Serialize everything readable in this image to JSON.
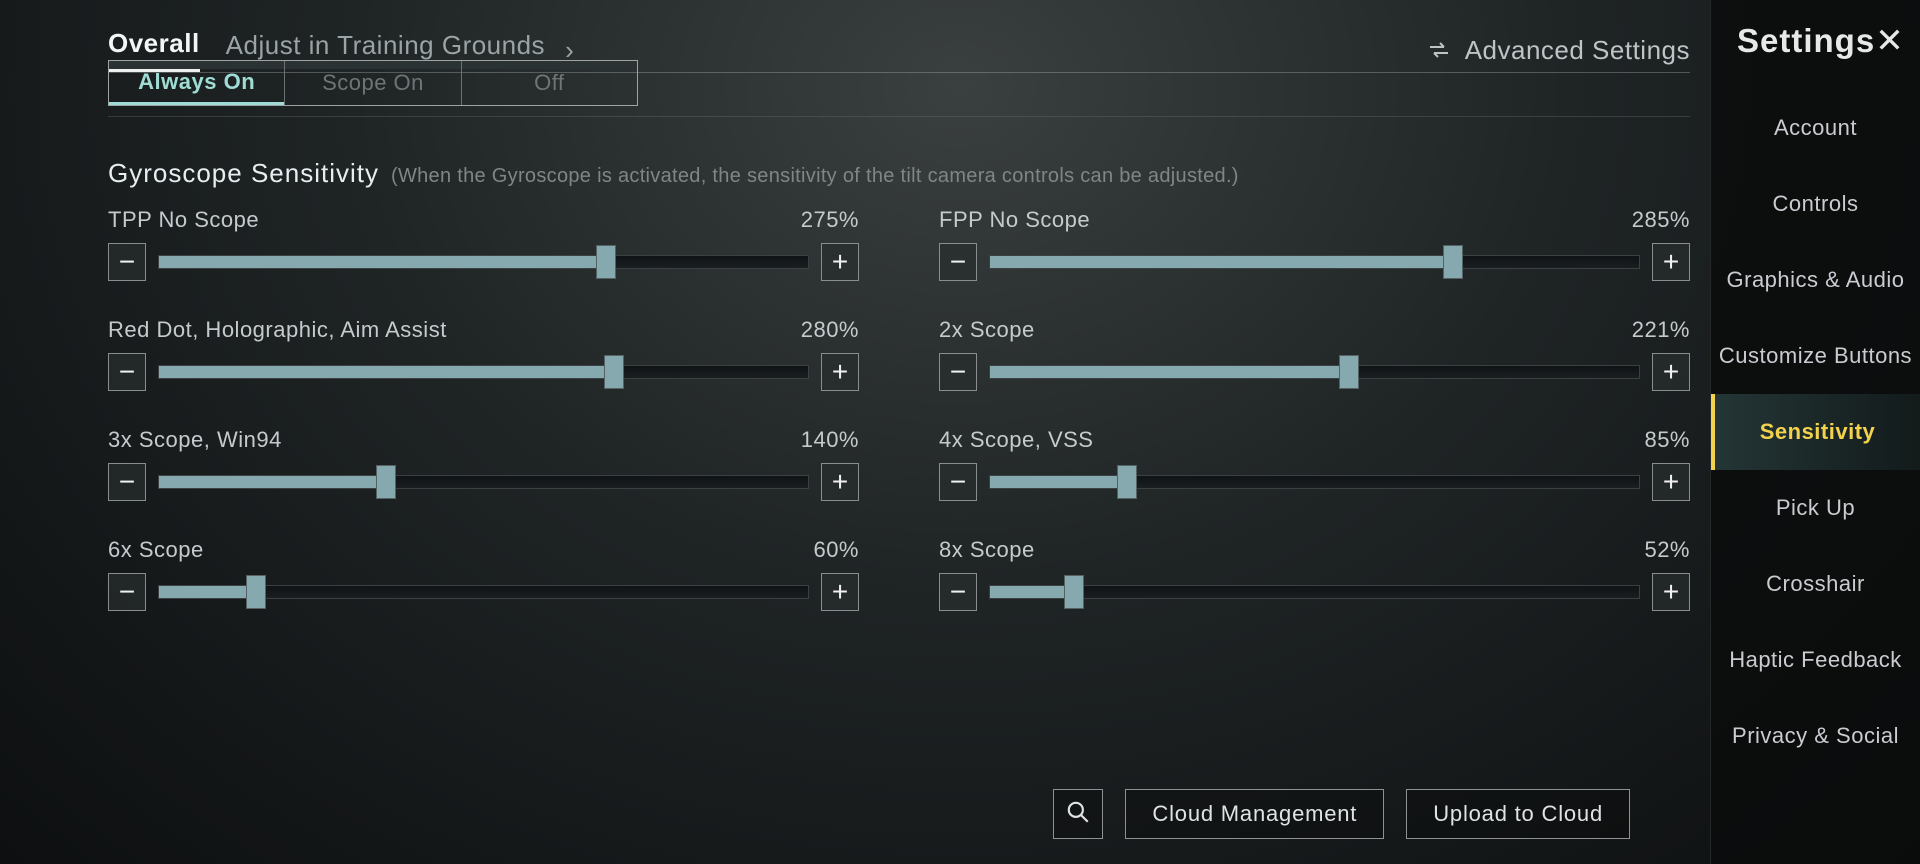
{
  "header": {
    "settings_label": "Settings",
    "advanced_label": "Advanced Settings",
    "tabs": [
      "Overall",
      "Adjust in Training Grounds"
    ],
    "active_tab_index": 0
  },
  "seg": {
    "options": [
      "Always On",
      "Scope On",
      "Off"
    ],
    "active_index": 0
  },
  "sidebar": {
    "items": [
      "Account",
      "Controls",
      "Graphics & Audio",
      "Customize Buttons",
      "Sensitivity",
      "Pick Up",
      "Crosshair",
      "Haptic Feedback",
      "Privacy & Social"
    ],
    "active_index": 4
  },
  "section": {
    "title": "Gyroscope Sensitivity",
    "hint": "(When the Gyroscope is activated, the sensitivity of the tilt camera controls can be adjusted.)"
  },
  "sliders": [
    {
      "label": "TPP No Scope",
      "value": 275,
      "display_max": 400
    },
    {
      "label": "FPP No Scope",
      "value": 285,
      "display_max": 400
    },
    {
      "label": "Red Dot, Holographic, Aim Assist",
      "value": 280,
      "display_max": 400
    },
    {
      "label": "2x Scope",
      "value": 221,
      "display_max": 400
    },
    {
      "label": "3x Scope, Win94",
      "value": 140,
      "display_max": 400
    },
    {
      "label": "4x Scope, VSS",
      "value": 85,
      "display_max": 400
    },
    {
      "label": "6x Scope",
      "value": 60,
      "display_max": 400
    },
    {
      "label": "8x Scope",
      "value": 52,
      "display_max": 400
    }
  ],
  "bottom": {
    "cloud_mgmt": "Cloud Management",
    "upload": "Upload to Cloud"
  },
  "glyphs": {
    "minus": "−",
    "plus": "+",
    "close": "✕",
    "chevron": "›"
  }
}
